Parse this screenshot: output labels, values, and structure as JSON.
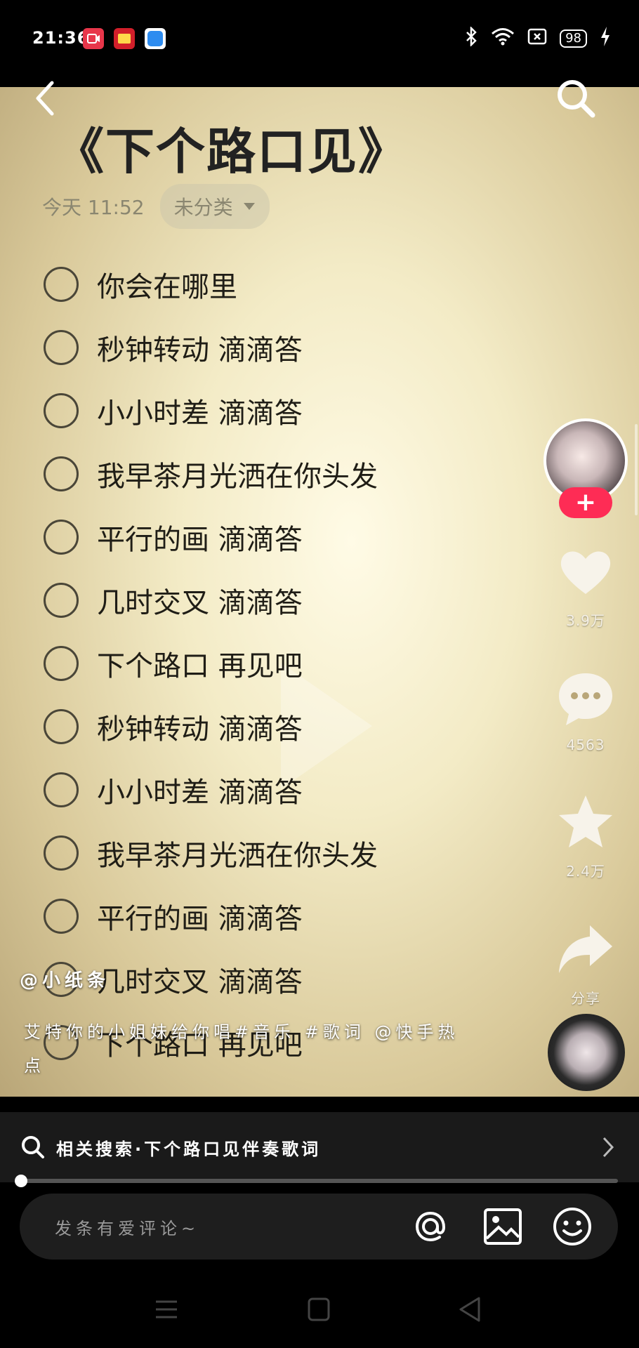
{
  "status_bar": {
    "time": "21:36",
    "battery": "98",
    "icons": [
      "video-app-icon",
      "red-app-icon",
      "blue-app-icon",
      "bluetooth-icon",
      "wifi-icon",
      "sim-icon",
      "battery-icon",
      "charging-icon"
    ]
  },
  "note": {
    "title": "《下个路口见》",
    "timestamp": "今天 11:52",
    "category": "未分类",
    "lines": [
      "你会在哪里",
      "秒钟转动 滴滴答",
      "小小时差 滴滴答",
      "我早茶月光洒在你头发",
      "平行的画 滴滴答",
      "几时交叉 滴滴答",
      "下个路口 再见吧",
      "秒钟转动 滴滴答",
      "小小时差 滴滴答",
      "我早茶月光洒在你头发",
      "平行的画 滴滴答",
      "几时交叉 滴滴答",
      "下个路口 再见吧"
    ]
  },
  "sidebar": {
    "likes": "3.9万",
    "comments": "4563",
    "favorites": "2.4万",
    "share": "分享",
    "follow_label": "+"
  },
  "author": "@小纸条",
  "caption": "艾特你的小姐妹给你唱#音乐 #歌词 @快手热点",
  "related_search": "相关搜索·下个路口见伴奏歌词",
  "progress": 0.0,
  "comment_placeholder": "发条有爱评论~",
  "colors": {
    "accent_red": "#fe2c55",
    "note_text": "#1f1d16"
  }
}
